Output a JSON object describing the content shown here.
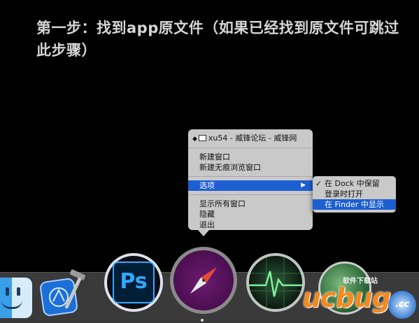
{
  "caption": "第一步：找到app原文件（如果已经找到原文件可跳过此步骤）",
  "context_menu": {
    "window_title": "xu54 - 威锋论坛 - 威锋网",
    "items_group1": [
      "新建窗口",
      "新建无痕浏览窗口"
    ],
    "options_label": "选项",
    "items_group3": [
      "显示所有窗口",
      "隐藏",
      "退出"
    ]
  },
  "submenu": {
    "items": [
      "在 Dock 中保留",
      "登录时打开",
      "在 Finder 中显示"
    ],
    "checked_index": 0,
    "selected_index": 2,
    "check_mark": "✓"
  },
  "dock": {
    "icons": [
      "finder-icon",
      "xcode-icon",
      "photoshop-icon",
      "safari-icon",
      "activity-monitor-icon",
      "globe-icon"
    ],
    "photoshop_label": "Ps"
  },
  "watermark": {
    "logo": "ucbug",
    "small_text": "软件下载站",
    "cc": ".cc"
  },
  "colors": {
    "selection": "#1c5fd1",
    "menu_bg": "#c9c9c9",
    "background": "#000000"
  }
}
